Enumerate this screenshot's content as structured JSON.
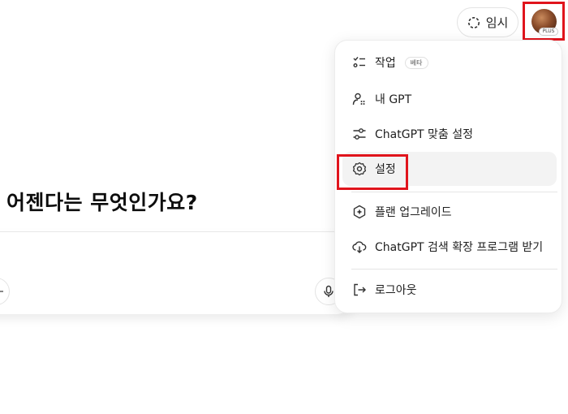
{
  "header": {
    "temporary_label": "임시",
    "avatar_badge": "PLUS"
  },
  "main": {
    "headline": "어젠다는 무엇인가요?"
  },
  "menu": {
    "items": [
      {
        "label": "작업",
        "badge": "베타",
        "icon": "tasks-icon"
      },
      {
        "label": "내 GPT",
        "icon": "my-gpts-icon"
      },
      {
        "label": "ChatGPT 맞춤 설정",
        "icon": "customize-icon"
      },
      {
        "label": "설정",
        "icon": "settings-gear-icon"
      },
      {
        "label": "플랜 업그레이드",
        "icon": "upgrade-plan-icon"
      },
      {
        "label": "ChatGPT 검색 확장 프로그램 받기",
        "icon": "search-extension-icon"
      },
      {
        "label": "로그아웃",
        "icon": "logout-icon"
      }
    ]
  },
  "colors": {
    "highlight": "#e0141c",
    "active_item_bg": "#f3f3f3"
  }
}
